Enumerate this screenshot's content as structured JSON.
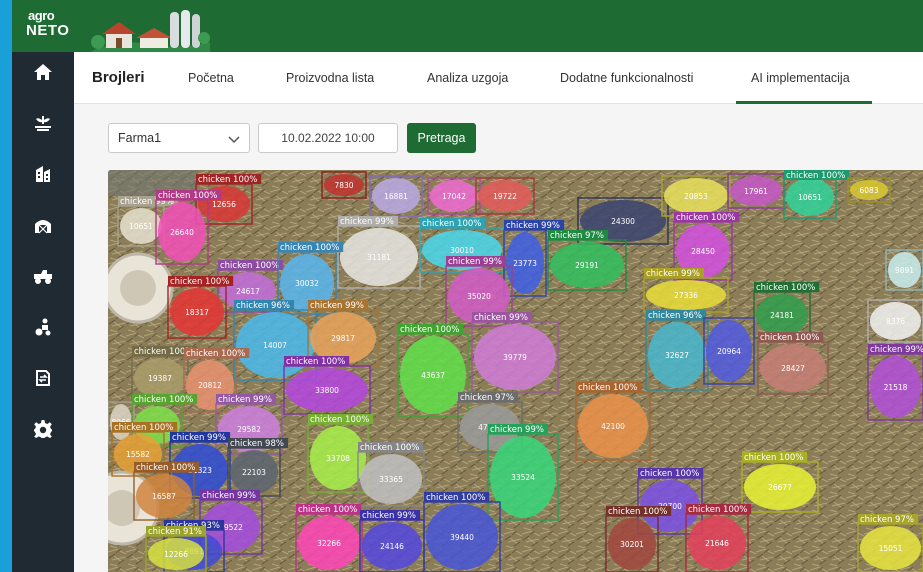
{
  "header": {
    "logo_top": "agro",
    "logo_bottom": "NETO"
  },
  "sidebar": {
    "items": [
      {
        "name": "home",
        "icon": "home-icon"
      },
      {
        "name": "plant",
        "icon": "plant-icon"
      },
      {
        "name": "building",
        "icon": "building-icon"
      },
      {
        "name": "barn",
        "icon": "barn-icon"
      },
      {
        "name": "tractor",
        "icon": "tractor-icon"
      },
      {
        "name": "farmer",
        "icon": "farmer-icon"
      },
      {
        "name": "transfer",
        "icon": "transfer-icon"
      },
      {
        "name": "settings",
        "icon": "gear-icon"
      }
    ]
  },
  "tabs": {
    "brand": "Brojleri",
    "items": [
      {
        "label": "Početna"
      },
      {
        "label": "Proizvodna lista"
      },
      {
        "label": "Analiza uzgoja"
      },
      {
        "label": "Dodatne funkcionalnosti"
      },
      {
        "label": "AI implementacija",
        "active": true
      }
    ]
  },
  "filters": {
    "farm": "Farma1",
    "datetime": "10.02.2022 10:00",
    "search_label": "Pretraga"
  },
  "detections": {
    "class_label": "chicken",
    "items": [
      {
        "id": "7830",
        "score": ""
      },
      {
        "id": "12656",
        "score": "100%"
      },
      {
        "id": "16881",
        "score": ""
      },
      {
        "id": "17042",
        "score": ""
      },
      {
        "id": "19722",
        "score": ""
      },
      {
        "id": "24300",
        "score": ""
      },
      {
        "id": "20853",
        "score": ""
      },
      {
        "id": "17961",
        "score": ""
      },
      {
        "id": "10651",
        "score": "100%"
      },
      {
        "id": "6083",
        "score": ""
      },
      {
        "id": "10651",
        "score": "99%"
      },
      {
        "id": "26640",
        "score": "100%"
      },
      {
        "id": "31181",
        "score": "99%"
      },
      {
        "id": "30010",
        "score": "100%"
      },
      {
        "id": "23773",
        "score": "99%"
      },
      {
        "id": "29191",
        "score": "97%"
      },
      {
        "id": "28450",
        "score": "100%"
      },
      {
        "id": "24617",
        "score": "100%"
      },
      {
        "id": "30032",
        "score": "100%"
      },
      {
        "id": "18317",
        "score": "100%"
      },
      {
        "id": "35020",
        "score": "99%"
      },
      {
        "id": "27336",
        "score": "99%"
      },
      {
        "id": "9891",
        "score": ""
      },
      {
        "id": "14007",
        "score": "96%"
      },
      {
        "id": "29817",
        "score": "99%"
      },
      {
        "id": "24181",
        "score": "100%"
      },
      {
        "id": "8376",
        "score": ""
      },
      {
        "id": "43637",
        "score": "100%"
      },
      {
        "id": "39779",
        "score": "99%"
      },
      {
        "id": "32627",
        "score": "96%"
      },
      {
        "id": "20964",
        "score": ""
      },
      {
        "id": "28427",
        "score": "100%"
      },
      {
        "id": "19387",
        "score": "100%"
      },
      {
        "id": "20812",
        "score": "100%"
      },
      {
        "id": "33800",
        "score": "100%"
      },
      {
        "id": "21518",
        "score": "99%"
      },
      {
        "id": "8966",
        "score": ""
      },
      {
        "id": "10810",
        "score": "100%"
      },
      {
        "id": "29582",
        "score": "99%"
      },
      {
        "id": "42100",
        "score": "100%"
      },
      {
        "id": "15582",
        "score": "100%"
      },
      {
        "id": "33708",
        "score": "100%"
      },
      {
        "id": "47413",
        "score": "97%"
      },
      {
        "id": "21323",
        "score": "99%"
      },
      {
        "id": "22103",
        "score": "98%"
      },
      {
        "id": "33365",
        "score": "100%"
      },
      {
        "id": "33524",
        "score": "99%"
      },
      {
        "id": "26677",
        "score": "100%"
      },
      {
        "id": "16587",
        "score": "100%"
      },
      {
        "id": "19522",
        "score": "99%"
      },
      {
        "id": "29700",
        "score": "100%"
      },
      {
        "id": "8891",
        "score": "93%"
      },
      {
        "id": "32266",
        "score": "100%"
      },
      {
        "id": "24146",
        "score": "99%"
      },
      {
        "id": "39440",
        "score": "100%"
      },
      {
        "id": "30201",
        "score": "100%"
      },
      {
        "id": "21646",
        "score": "100%"
      },
      {
        "id": "15051",
        "score": "97%"
      },
      {
        "id": "12266",
        "score": "91%"
      }
    ]
  },
  "colors": {
    "header_green": "#1e6b33",
    "sidebar_dark": "#1f2a33",
    "accent_blue": "#1aa0d8"
  }
}
